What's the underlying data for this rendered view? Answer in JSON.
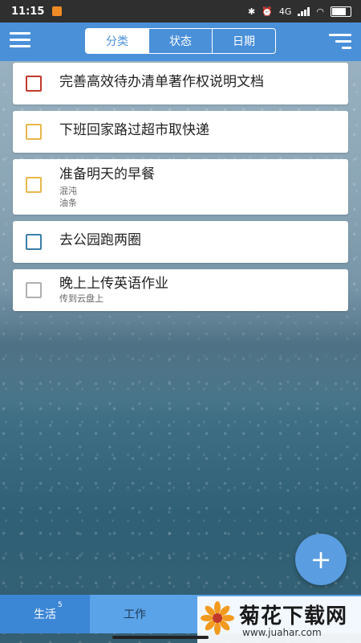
{
  "status_bar": {
    "time": "11:15",
    "network": "4G"
  },
  "header": {
    "tabs": [
      {
        "label": "分类",
        "active": true
      },
      {
        "label": "状态",
        "active": false
      },
      {
        "label": "日期",
        "active": false
      }
    ]
  },
  "tasks": [
    {
      "title": "完善高效待办清单著作权说明文档",
      "notes": [],
      "color": "#c0392b"
    },
    {
      "title": "下班回家路过超市取快递",
      "notes": [],
      "color": "#e6b84a"
    },
    {
      "title": "准备明天的早餐",
      "notes": [
        "混沌",
        "油条"
      ],
      "color": "#e6b84a"
    },
    {
      "title": "去公园跑两圈",
      "notes": [],
      "color": "#3a7fa8"
    },
    {
      "title": "晚上上传英语作业",
      "notes": [
        "传到云盘上"
      ],
      "color": "#b0b0b0"
    }
  ],
  "fab": {
    "label": "+"
  },
  "bottom_tabs": [
    {
      "label": "生活",
      "badge": "5",
      "active": true
    },
    {
      "label": "工作",
      "badge": "",
      "active": false
    }
  ],
  "watermark": {
    "title": "菊花下载网",
    "url": "www.juahar.com"
  },
  "colors": {
    "header": "#4a90d9",
    "bottom_bar": "#5aa3e8",
    "fab": "#5a9de0"
  }
}
